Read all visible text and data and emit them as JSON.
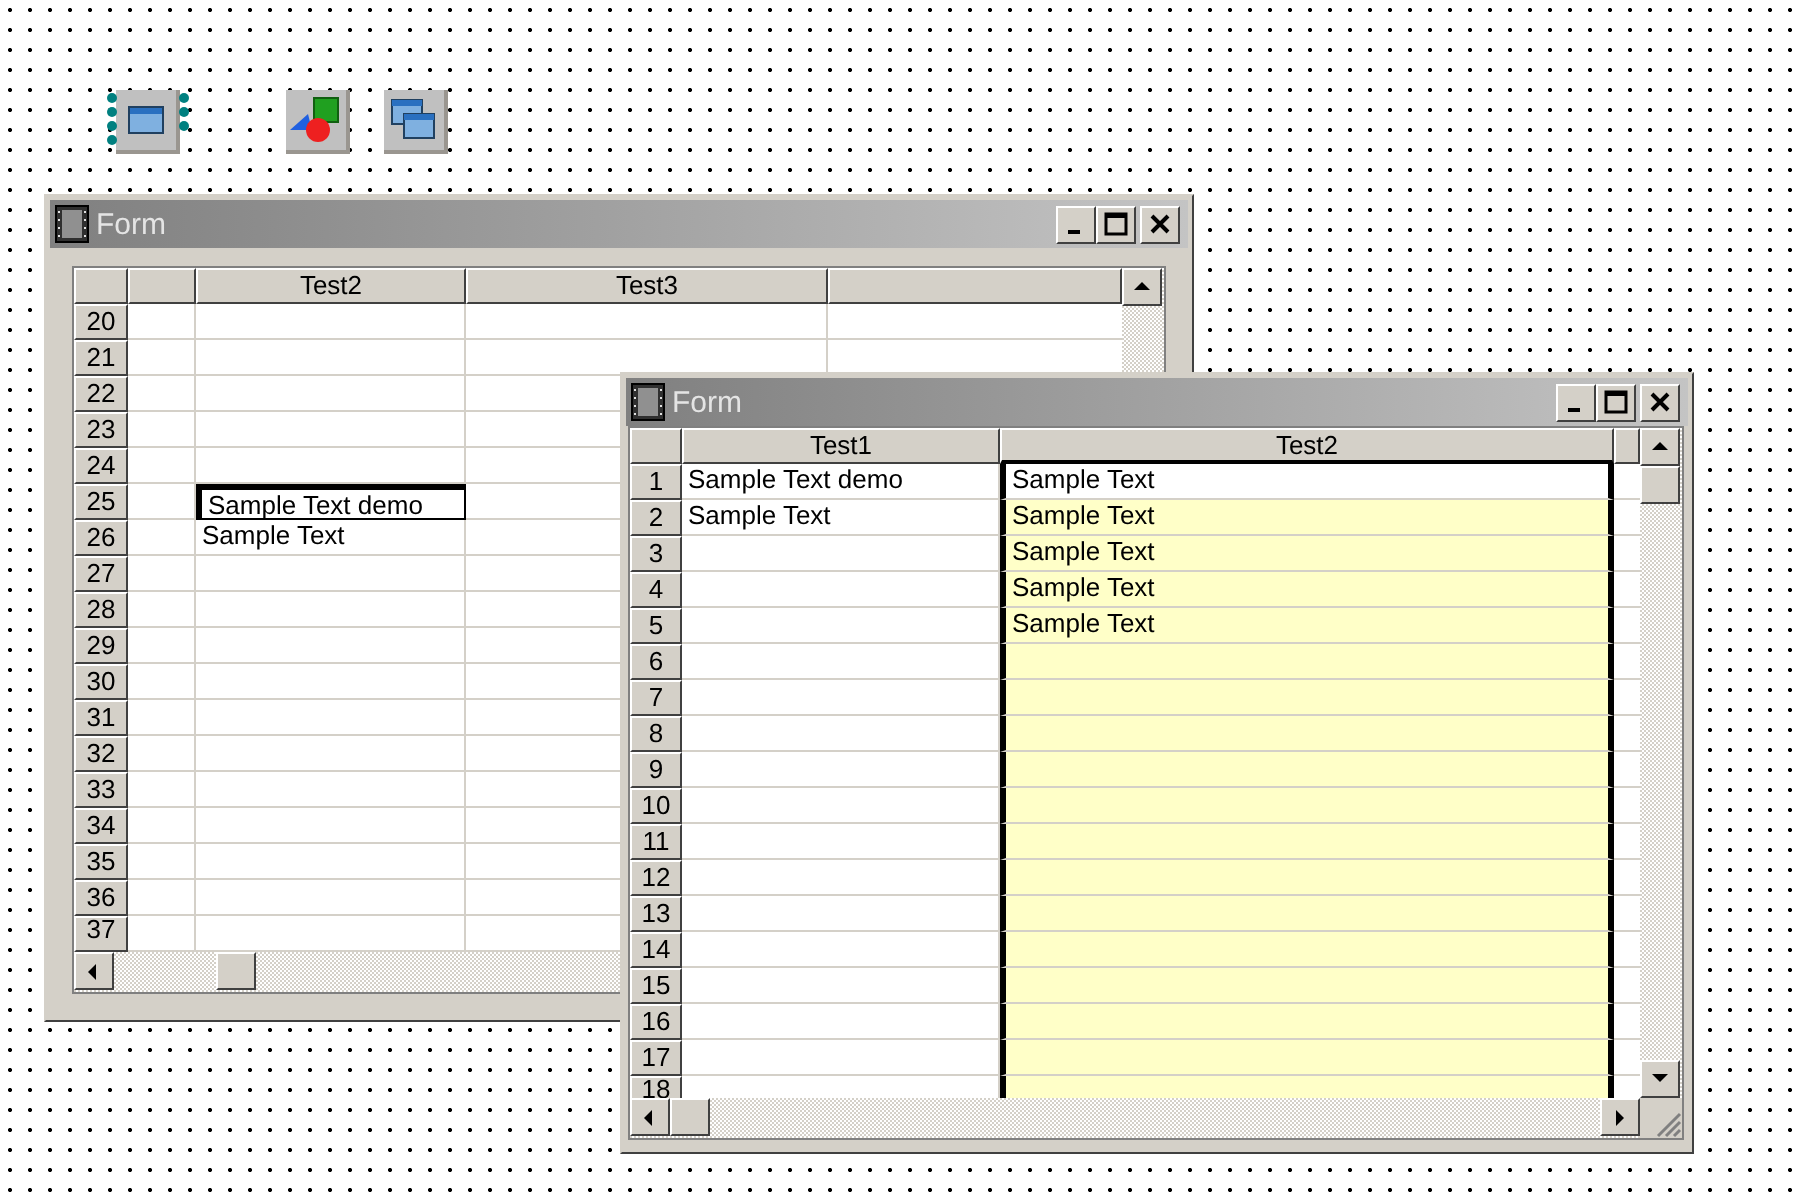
{
  "forms": [
    {
      "title": "Form",
      "columns": [
        {
          "selected": false
        },
        {
          "label": "Test2",
          "selected": false
        },
        {
          "label": "Test3",
          "selected": false
        }
      ],
      "rows": [
        {
          "header": "20",
          "cells": [
            {
              "selected": false
            },
            {
              "selected": false
            },
            {
              "selected": false
            }
          ]
        },
        {
          "header": "21",
          "cells": [
            {
              "selected": false
            },
            {
              "selected": false
            },
            {
              "selected": false
            }
          ]
        },
        {
          "header": "22",
          "cells": [
            {
              "selected": false
            },
            {
              "selected": false
            },
            {
              "selected": false
            }
          ]
        },
        {
          "header": "23",
          "cells": [
            {
              "selected": false
            },
            {
              "selected": false
            },
            {
              "selected": false
            }
          ]
        },
        {
          "header": "24",
          "cells": [
            {
              "selected": false
            },
            {
              "selected": false
            },
            {
              "selected": false
            }
          ]
        },
        {
          "header": "25",
          "cells": [
            {
              "selected": false
            },
            {
              "text": "Sample Text demo",
              "selected": true
            },
            {
              "selected": false
            }
          ]
        },
        {
          "header": "26",
          "cells": [
            {
              "selected": false
            },
            {
              "text": "Sample Text",
              "selected": false
            },
            {
              "selected": false
            }
          ]
        },
        {
          "header": "27",
          "cells": [
            {
              "selected": false
            },
            {
              "selected": false
            },
            {
              "selected": false
            }
          ]
        },
        {
          "header": "28",
          "cells": [
            {
              "selected": false
            },
            {
              "selected": false
            },
            {
              "selected": false
            }
          ]
        },
        {
          "header": "29",
          "cells": [
            {
              "selected": false
            },
            {
              "selected": false
            },
            {
              "selected": false
            }
          ]
        },
        {
          "header": "30",
          "cells": [
            {
              "selected": false
            },
            {
              "selected": false
            },
            {
              "selected": false
            }
          ]
        },
        {
          "header": "31",
          "cells": [
            {
              "selected": false
            },
            {
              "selected": false
            },
            {
              "selected": false
            }
          ]
        },
        {
          "header": "32",
          "cells": [
            {
              "selected": false
            },
            {
              "selected": false
            },
            {
              "selected": false
            }
          ]
        },
        {
          "header": "33",
          "cells": [
            {
              "selected": false
            },
            {
              "selected": false
            },
            {
              "selected": false
            }
          ]
        },
        {
          "header": "34",
          "cells": [
            {
              "selected": false
            },
            {
              "selected": false
            },
            {
              "selected": false
            }
          ]
        },
        {
          "header": "35",
          "cells": [
            {
              "selected": false
            },
            {
              "selected": false
            },
            {
              "selected": false
            }
          ]
        },
        {
          "header": "36",
          "cells": [
            {
              "selected": false
            },
            {
              "selected": false
            },
            {
              "selected": false
            }
          ]
        },
        {
          "header": "37",
          "cells": [
            {
              "selected": false
            },
            {
              "selected": false
            },
            {
              "selected": false
            }
          ]
        }
      ]
    },
    {
      "title": "Form",
      "columns": [
        {
          "label": "Test1",
          "selected": false
        },
        {
          "label": "Test2",
          "selected": true
        }
      ],
      "rows": [
        {
          "header": "1",
          "cells": [
            {
              "text": "Sample Text demo",
              "selected": false
            },
            {
              "text": "Sample Text",
              "selected": true
            }
          ]
        },
        {
          "header": "2",
          "cells": [
            {
              "text": "Sample Text",
              "selected": false
            },
            {
              "text": "Sample Text",
              "selected": false
            }
          ]
        },
        {
          "header": "3",
          "cells": [
            {
              "selected": false
            },
            {
              "text": "Sample Text",
              "selected": false
            }
          ]
        },
        {
          "header": "4",
          "cells": [
            {
              "selected": false
            },
            {
              "text": "Sample Text",
              "selected": false
            }
          ]
        },
        {
          "header": "5",
          "cells": [
            {
              "selected": false
            },
            {
              "text": "Sample Text",
              "selected": false
            }
          ]
        },
        {
          "header": "6",
          "cells": [
            {
              "selected": false
            },
            {
              "selected": false
            }
          ]
        },
        {
          "header": "7",
          "cells": [
            {
              "selected": false
            },
            {
              "selected": false
            }
          ]
        },
        {
          "header": "8",
          "cells": [
            {
              "selected": false
            },
            {
              "selected": false
            }
          ]
        },
        {
          "header": "9",
          "cells": [
            {
              "selected": false
            },
            {
              "selected": false
            }
          ]
        },
        {
          "header": "10",
          "cells": [
            {
              "selected": false
            },
            {
              "selected": false
            }
          ]
        },
        {
          "header": "11",
          "cells": [
            {
              "selected": false
            },
            {
              "selected": false
            }
          ]
        },
        {
          "header": "12",
          "cells": [
            {
              "selected": false
            },
            {
              "selected": false
            }
          ]
        },
        {
          "header": "13",
          "cells": [
            {
              "selected": false
            },
            {
              "selected": false
            }
          ]
        },
        {
          "header": "14",
          "cells": [
            {
              "selected": false
            },
            {
              "selected": false
            }
          ]
        },
        {
          "header": "15",
          "cells": [
            {
              "selected": false
            },
            {
              "selected": false
            }
          ]
        },
        {
          "header": "16",
          "cells": [
            {
              "selected": false
            },
            {
              "selected": false
            }
          ]
        },
        {
          "header": "17",
          "cells": [
            {
              "selected": false
            },
            {
              "selected": false
            }
          ]
        },
        {
          "header": "18",
          "cells": [
            {
              "selected": false
            },
            {
              "selected": false
            }
          ]
        }
      ]
    }
  ]
}
